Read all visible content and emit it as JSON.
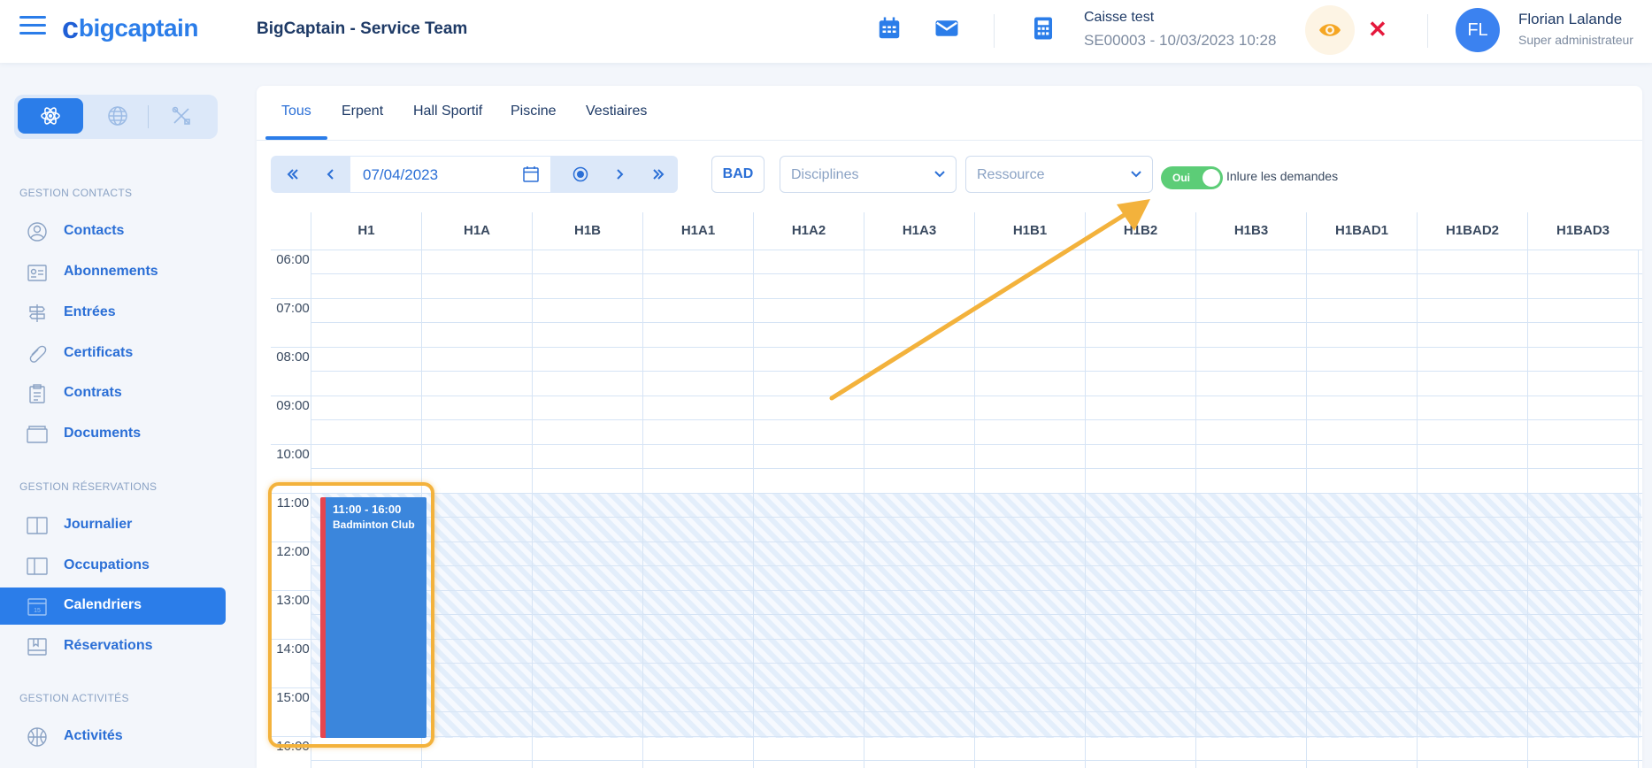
{
  "header": {
    "logo_text": "bigcaptain",
    "team_title": "BigCaptain - Service Team",
    "caisse_title": "Caisse test",
    "caisse_session": "SE00003 - 10/03/2023 10:28",
    "user_initials": "FL",
    "user_name": "Florian Lalande",
    "user_role": "Super administrateur",
    "icons": [
      "menu-icon",
      "calendar-icon",
      "mail-icon",
      "calculator-icon",
      "eye-icon",
      "close-icon"
    ]
  },
  "sidebar": {
    "modes": [
      "atom-icon",
      "globe-icon",
      "tools-icon"
    ],
    "sections": [
      {
        "title": "GESTION CONTACTS",
        "items": [
          "Contacts",
          "Abonnements",
          "Entrées",
          "Certificats",
          "Contrats",
          "Documents"
        ]
      },
      {
        "title": "GESTION RÉSERVATIONS",
        "items": [
          "Journalier",
          "Occupations",
          "Calendriers",
          "Réservations"
        ]
      },
      {
        "title": "GESTION ACTIVITÉS",
        "items": [
          "Activités"
        ]
      }
    ],
    "active_item": "Calendriers"
  },
  "tabs": [
    "Tous",
    "Erpent",
    "Hall Sportif",
    "Piscine",
    "Vestiaires"
  ],
  "active_tab": "Tous",
  "toolbar": {
    "date": "07/04/2023",
    "bad_label": "BAD",
    "disciplines_placeholder": "Disciplines",
    "ressource_placeholder": "Ressource",
    "toggle_label": "Oui",
    "toggle_text": "Inlure les demandes"
  },
  "grid": {
    "columns": [
      "H1",
      "H1A",
      "H1B",
      "H1A1",
      "H1A2",
      "H1A3",
      "H1B1",
      "H1B2",
      "H1B3",
      "H1BAD1",
      "H1BAD2",
      "H1BAD3"
    ],
    "times": [
      "06:00",
      "07:00",
      "08:00",
      "09:00",
      "10:00",
      "11:00",
      "12:00",
      "13:00",
      "14:00",
      "15:00",
      "16:00"
    ]
  },
  "event": {
    "time": "11:00 - 16:00",
    "name": "Badminton Club"
  },
  "colors": {
    "accent": "#2b7de9",
    "event": "#3b86dc",
    "event_border": "#e5454f",
    "toggle_on": "#5ccd77",
    "annotation": "#f3b23c"
  }
}
